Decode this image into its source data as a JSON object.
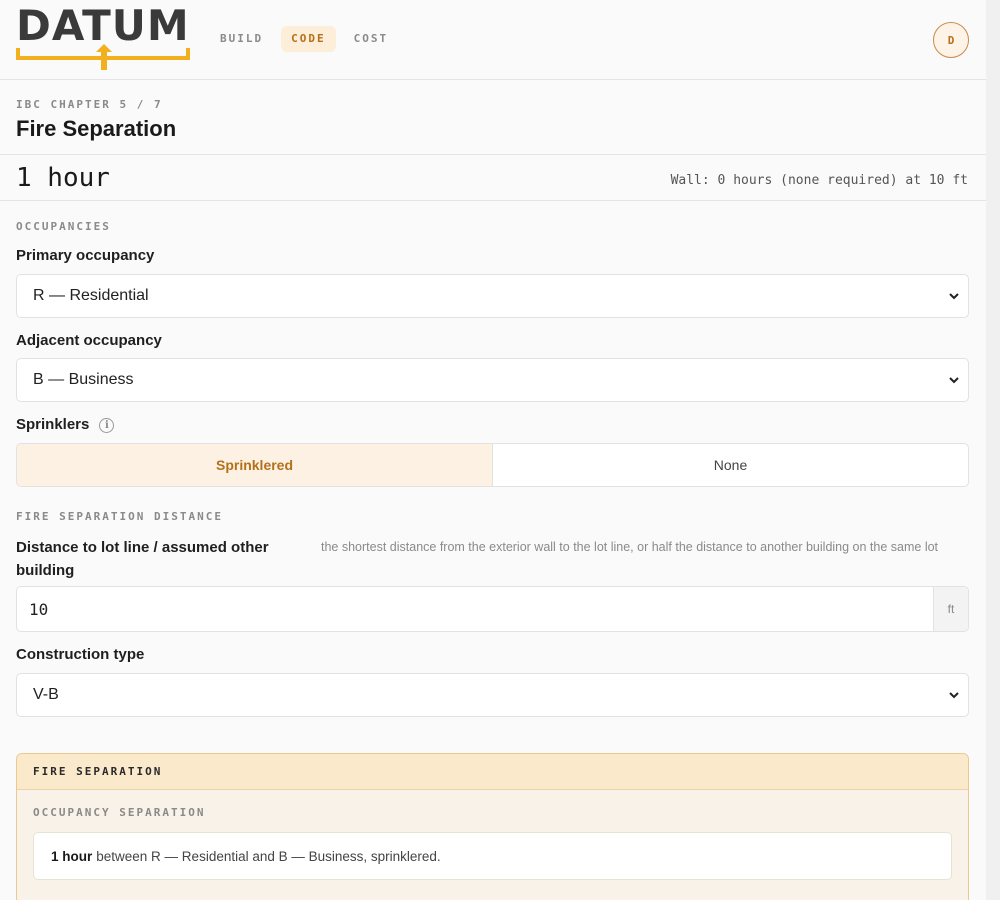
{
  "brand": {
    "name": "DATUM",
    "accent": "#f2b01e",
    "text_color": "#3a3a3a"
  },
  "nav": [
    {
      "label": "BUILD",
      "active": false
    },
    {
      "label": "CODE",
      "active": true
    },
    {
      "label": "COST",
      "active": false
    }
  ],
  "user": {
    "initial": "D"
  },
  "page": {
    "breadcrumb": "IBC CHAPTER 5 / 7",
    "title": "Fire Separation"
  },
  "result": {
    "rating": "1 hour",
    "wall_note": "Wall: 0 hours (none required) at 10 ft"
  },
  "occupancies": {
    "section_label": "OCCUPANCIES",
    "primary_label": "Primary occupancy",
    "primary_value": "R — Residential",
    "adjacent_label": "Adjacent occupancy",
    "adjacent_value": "B — Business",
    "sprinklers_label": "Sprinklers",
    "sprinkler_options": [
      {
        "label": "Sprinklered",
        "active": true
      },
      {
        "label": "None",
        "active": false
      }
    ]
  },
  "distance": {
    "section_label": "FIRE SEPARATION DISTANCE",
    "label": "Distance to lot line / assumed other building",
    "hint": "the shortest distance from the exterior wall to the lot line, or half the distance to another building on the same lot",
    "value": "10",
    "unit": "ft",
    "construction_label": "Construction type",
    "construction_value": "V-B"
  },
  "card": {
    "title": "FIRE SEPARATION",
    "subtitle": "OCCUPANCY SEPARATION",
    "rating": "1 hour",
    "summary": "between R — Residential and B — Business, sprinklered."
  }
}
